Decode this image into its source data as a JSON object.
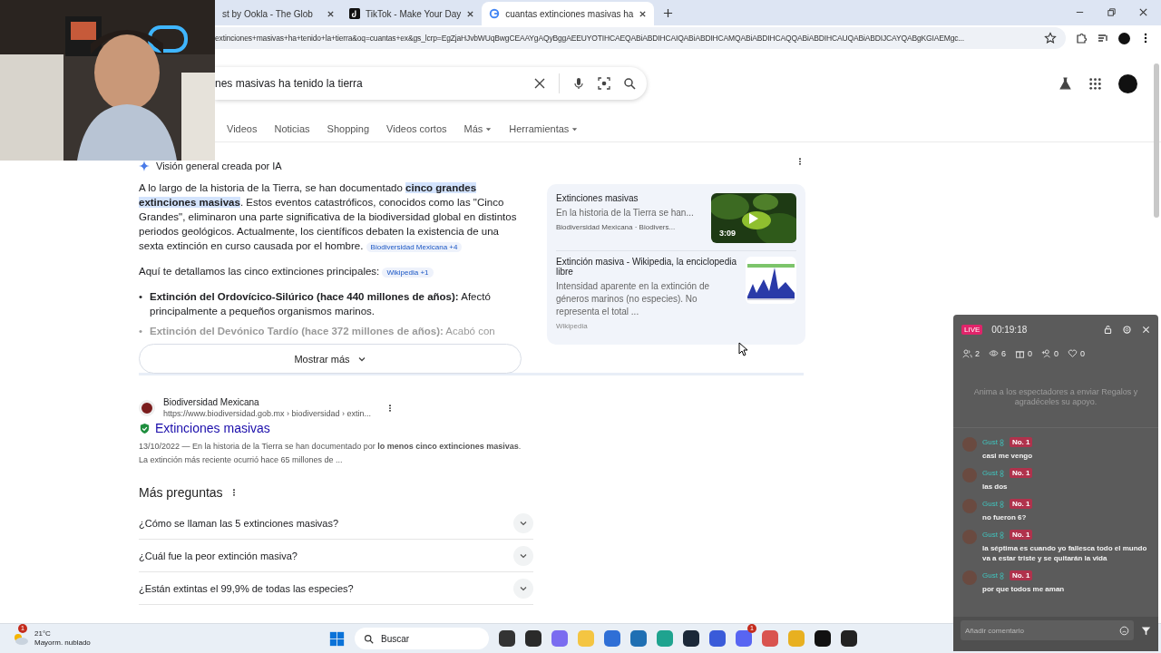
{
  "browser": {
    "tabs": [
      {
        "title": "st by Ookla - The Glob",
        "kind": "plain",
        "selected": false
      },
      {
        "title": "TikTok - Make Your Day",
        "kind": "tiktok",
        "selected": false
      },
      {
        "title": "cuantas extinciones masivas ha",
        "kind": "google",
        "selected": true
      }
    ],
    "url": "extinciones+masivas+ha+tenido+la+tierra&oq=cuantas+ex&gs_lcrp=EgZjaHJvbWUqBwgCEAAYgAQyBggAEEUYOTIHCAEQABiABDIHCAIQABiABDIHCAMQABiABDIHCAQQABiABDIHCAUQABiABDIJCAYQABgKGIAEMgc..."
  },
  "search": {
    "query": "nes masivas ha tenido la tierra"
  },
  "filters": [
    {
      "label": "Videos",
      "dropdown": false
    },
    {
      "label": "Noticias",
      "dropdown": false
    },
    {
      "label": "Shopping",
      "dropdown": false
    },
    {
      "label": "Videos cortos",
      "dropdown": false
    },
    {
      "label": "Más",
      "dropdown": true
    },
    {
      "label": "Herramientas",
      "dropdown": true
    }
  ],
  "ai_overview": {
    "title": "Visión general creada por IA",
    "paragraph": "A lo largo de la historia de la Tierra, se han documentado **cinco grandes extinciones masivas**. Estos eventos catastróficos, conocidos como las \"Cinco Grandes\", eliminaron una parte significativa de la biodiversidad global en distintos periodos geológicos. Actualmente, los científicos debaten la existencia de una sexta extinción en curso causada por el hombre.",
    "paragraph_source": "Biodiversidad Mexicana +4",
    "intro": "Aquí te detallamos las cinco extinciones principales:",
    "intro_source": "Wikipedia +1",
    "bullets": [
      {
        "marker": "•",
        "text": "**Extinción del Ordovícico-Silúrico (hace 440 millones de años):** Afectó principalmente a pequeños organismos marinos.",
        "faded": false
      },
      {
        "marker": "•",
        "text": "**Extinción del Devónico Tardío (hace 372 millones de años):** Acabó con",
        "faded": true
      }
    ],
    "show_more": "Mostrar más",
    "sources": [
      {
        "title": "Extinciones masivas",
        "snippet": "En la historia de la Tierra se han...",
        "site": "Biodiversidad Mexicana · Biodivers...",
        "kind": "video",
        "duration": "3:09",
        "faded": false
      },
      {
        "title": "Extinción masiva - Wikipedia, la enciclopedia libre",
        "snippet": "Intensidad aparente en la extinción de géneros marinos (no especies). No representa el total ...",
        "site": "Wikipedia",
        "kind": "chart",
        "faded": true
      }
    ]
  },
  "result": {
    "site": "Biodiversidad Mexicana",
    "url": "https://www.biodiversidad.gob.mx › biodiversidad › extin...",
    "title": "Extinciones masivas",
    "snippet": "13/10/2022 — En la historia de la Tierra se han documentado por **lo menos cinco extinciones masivas**. La extinción más reciente ocurrió hace 65 millones de ..."
  },
  "questions": {
    "title": "Más preguntas",
    "items": [
      {
        "text": "¿Cómo se llaman las 5 extinciones masivas?",
        "expanded": false
      },
      {
        "text": "¿Cuál fue la peor extinción masiva?",
        "expanded": false
      },
      {
        "text": "¿Están extintas el 99,9% de todas las especies?",
        "expanded": false
      }
    ]
  },
  "live_panel": {
    "badge": "LIVE",
    "timer": "00:19:18",
    "stats": [
      {
        "kind": "people",
        "value": "2"
      },
      {
        "kind": "views",
        "value": "6"
      },
      {
        "kind": "gifts",
        "value": "0"
      },
      {
        "kind": "follow",
        "value": "0"
      },
      {
        "kind": "likes",
        "value": "0"
      }
    ],
    "hint": "Anima a los espectadores a enviar Regalos y agradéceles su apoyo.",
    "comments": [
      {
        "user": "Gust",
        "rank": "No. 1",
        "text": "casi me vengo"
      },
      {
        "user": "Gust",
        "rank": "No. 1",
        "text": "las dos"
      },
      {
        "user": "Gust",
        "rank": "No. 1",
        "text": "no fueron 6?"
      },
      {
        "user": "Gust",
        "rank": "No. 1",
        "text": "la séptima es cuando yo fallesca todo el mundo va a estar triste y se quitarán la vida"
      },
      {
        "user": "Gust",
        "rank": "No. 1",
        "text": "por que todos me aman"
      }
    ],
    "placeholder": "Añadir comentario"
  },
  "taskbar": {
    "weather": {
      "temp": "21°C",
      "desc": "Mayorm. nublado",
      "badge": "1"
    },
    "search": "Buscar",
    "apps": [
      {
        "kind": "taskview"
      },
      {
        "kind": "epic"
      },
      {
        "kind": "copilot"
      },
      {
        "kind": "folder"
      },
      {
        "kind": "store"
      },
      {
        "kind": "mail"
      },
      {
        "kind": "edge"
      },
      {
        "kind": "steam"
      },
      {
        "kind": "ea"
      },
      {
        "kind": "discord",
        "badge": "1"
      },
      {
        "kind": "tiles"
      },
      {
        "kind": "chrome"
      },
      {
        "kind": "tiktok"
      },
      {
        "kind": "game"
      }
    ]
  }
}
